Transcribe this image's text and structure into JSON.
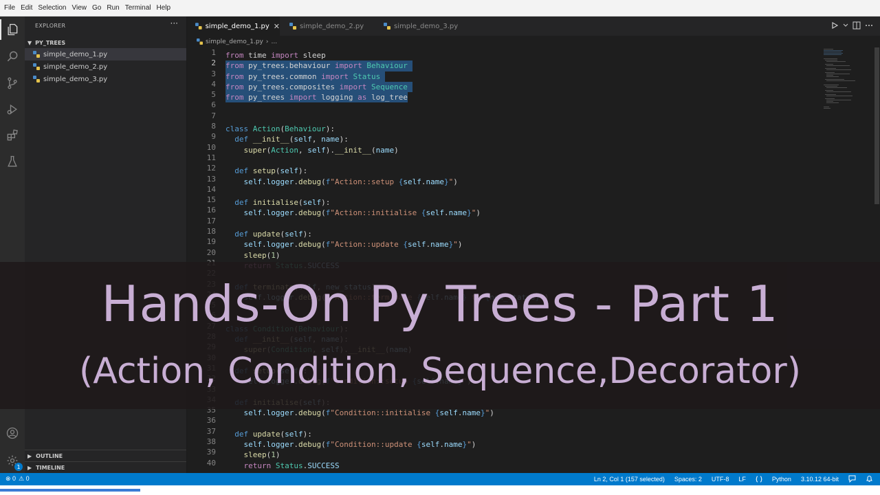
{
  "menubar": {
    "items": [
      "File",
      "Edit",
      "Selection",
      "View",
      "Go",
      "Run",
      "Terminal",
      "Help"
    ]
  },
  "activity_bar": {
    "icons": [
      "files-icon",
      "search-icon",
      "source-control-icon",
      "run-debug-icon",
      "extensions-icon",
      "testing-icon",
      "account-icon",
      "gear-icon"
    ],
    "manage_badge": "1"
  },
  "sidebar": {
    "title": "EXPLORER",
    "more": "···",
    "folder": "PY_TREES",
    "files": [
      "simple_demo_1.py",
      "simple_demo_2.py",
      "simple_demo_3.py"
    ],
    "outline": "OUTLINE",
    "timeline": "TIMELINE"
  },
  "tabs": [
    {
      "label": "simple_demo_1.py",
      "active": true
    },
    {
      "label": "simple_demo_2.py",
      "active": false
    },
    {
      "label": "simple_demo_3.py",
      "active": false
    }
  ],
  "tab_close": "✕",
  "breadcrumb": {
    "file": "simple_demo_1.py",
    "sep": "›",
    "rest": "..."
  },
  "editor": {
    "line_numbers": [
      "1",
      "2",
      "3",
      "4",
      "5",
      "6",
      "7",
      "8",
      "9",
      "10",
      "11",
      "12",
      "13",
      "14",
      "15",
      "16",
      "17",
      "18",
      "19",
      "20",
      "21",
      "22",
      "23",
      "24",
      "25",
      "26",
      "27",
      "28",
      "29",
      "30",
      "31",
      "32",
      "33",
      "34",
      "35",
      "36",
      "37",
      "38",
      "39",
      "40"
    ],
    "current_line": "2"
  },
  "statusbar": {
    "errors": "⊗ 0",
    "warnings": "⚠ 0",
    "position": "Ln 2, Col 1 (157 selected)",
    "spaces": "Spaces: 2",
    "encoding": "UTF-8",
    "eol": "LF",
    "language": "Python",
    "interpreter": "3.10.12 64-bit"
  },
  "overlay": {
    "line1": "Hands-On Py Trees - Part 1",
    "line2": "(Action, Condition, Sequence,Decorator)"
  },
  "colors": {
    "accent": "#007acc",
    "title_text": "#c8aed4",
    "selection": "#264f78"
  }
}
